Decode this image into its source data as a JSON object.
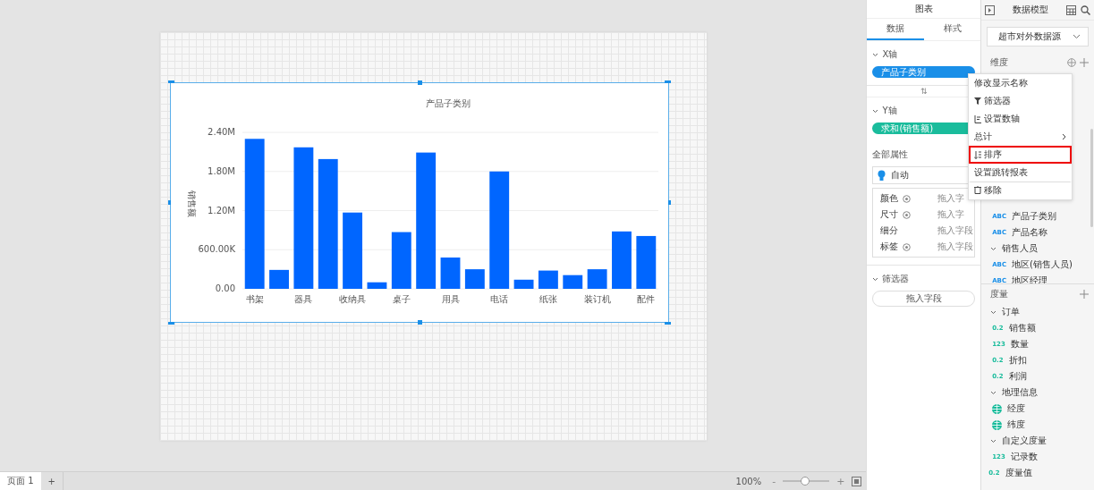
{
  "canvas": {
    "chart": {
      "chart_data": {
        "type": "bar",
        "title": "产品子类别",
        "ylabel": "销售额",
        "categories": [
          "书架",
          null,
          "器具",
          null,
          "收纳具",
          null,
          "桌子",
          null,
          "用具",
          null,
          "电话",
          null,
          "纸张",
          null,
          "装订机",
          null,
          "配件"
        ],
        "grid": true,
        "series": [
          {
            "color": "#0066ff",
            "values": [
              2300000,
              290000,
              2170000,
              1990000,
              1170000,
              100000,
              870000,
              2090000,
              480000,
              300000,
              1800000,
              140000,
              280000,
              210000,
              300000,
              880000,
              810000
            ]
          }
        ],
        "ylim": [
          0,
          2400000
        ],
        "yticks": [
          {
            "value": 0,
            "label": "0.00"
          },
          {
            "value": 600000,
            "label": "600.00K"
          },
          {
            "value": 1200000,
            "label": "1.20M"
          },
          {
            "value": 1800000,
            "label": "1.80M"
          },
          {
            "value": 2400000,
            "label": "2.40M"
          }
        ]
      }
    }
  },
  "bottom_bar": {
    "pages": [
      {
        "label": "页面 1",
        "selected": true
      }
    ],
    "add_page": "+",
    "zoom": "100%",
    "zoom_out": "-",
    "zoom_in": "+",
    "zoom_slider": {
      "level": 0.48
    }
  },
  "chart_panel": {
    "title": "图表",
    "tabs": [
      {
        "label": "数据",
        "selected": true
      },
      {
        "label": "样式",
        "selected": false
      }
    ],
    "x_axis": {
      "label": "X轴",
      "field": "产品子类别"
    },
    "swap": "⇅",
    "y_axis": {
      "label": "Y轴",
      "field": "求和(销售额)"
    },
    "properties": {
      "label": "全部属性",
      "mode": "自动",
      "rows": [
        {
          "label": "颜色",
          "gear": true,
          "value": "拖入字"
        },
        {
          "label": "尺寸",
          "gear": true,
          "value": "拖入字"
        },
        {
          "label": "细分",
          "gear": false,
          "value": "拖入字段"
        },
        {
          "label": "标签",
          "gear": true,
          "value": "拖入字段"
        }
      ]
    },
    "filter": {
      "label": "筛选器",
      "drop": "拖入字段"
    }
  },
  "data_panel": {
    "title": "数据模型",
    "source": "超市对外数据源",
    "dimensions": {
      "label": "维度",
      "fields": [
        {
          "kind": "text",
          "badge": "ABC",
          "name": "产品子类别"
        },
        {
          "kind": "text",
          "badge": "ABC",
          "name": "产品名称"
        },
        {
          "kind": "group",
          "name": "销售人员",
          "expanded": true,
          "children": [
            {
              "kind": "text",
              "badge": "ABC",
              "name": "地区(销售人员)"
            },
            {
              "kind": "text",
              "badge": "ABC",
              "name": "地区经理"
            }
          ]
        }
      ]
    },
    "measures": {
      "label": "度量",
      "fields": [
        {
          "kind": "group",
          "name": "订单",
          "expanded": true,
          "children": [
            {
              "kind": "number",
              "badge": "0.2",
              "name": "销售额"
            },
            {
              "kind": "number",
              "badge": "123",
              "name": "数量"
            },
            {
              "kind": "number",
              "badge": "0.2",
              "name": "折扣"
            },
            {
              "kind": "number",
              "badge": "0.2",
              "name": "利润"
            }
          ]
        },
        {
          "kind": "group",
          "name": "地理信息",
          "expanded": true,
          "children": [
            {
              "kind": "geo",
              "name": "经度"
            },
            {
              "kind": "geo",
              "name": "纬度"
            }
          ]
        },
        {
          "kind": "group",
          "name": "自定义度量",
          "expanded": true,
          "children": [
            {
              "kind": "number",
              "badge": "123",
              "name": "记录数"
            }
          ]
        },
        {
          "kind": "number",
          "badge": "0.2",
          "name": "度量值"
        }
      ]
    }
  },
  "context_menu": {
    "items": [
      {
        "kind": "plain",
        "label": "修改显示名称",
        "selected": false
      },
      {
        "kind": "filter",
        "label": "筛选器",
        "selected": false
      },
      {
        "kind": "axis",
        "label": "设置数轴",
        "selected": false
      },
      {
        "kind": "submenu",
        "label": "总计",
        "selected": false
      },
      {
        "kind": "sort",
        "label": "排序",
        "selected": true
      },
      {
        "kind": "plain",
        "label": "设置跳转报表",
        "selected": false
      },
      {
        "kind": "remove",
        "label": "移除",
        "selected": false
      }
    ]
  }
}
